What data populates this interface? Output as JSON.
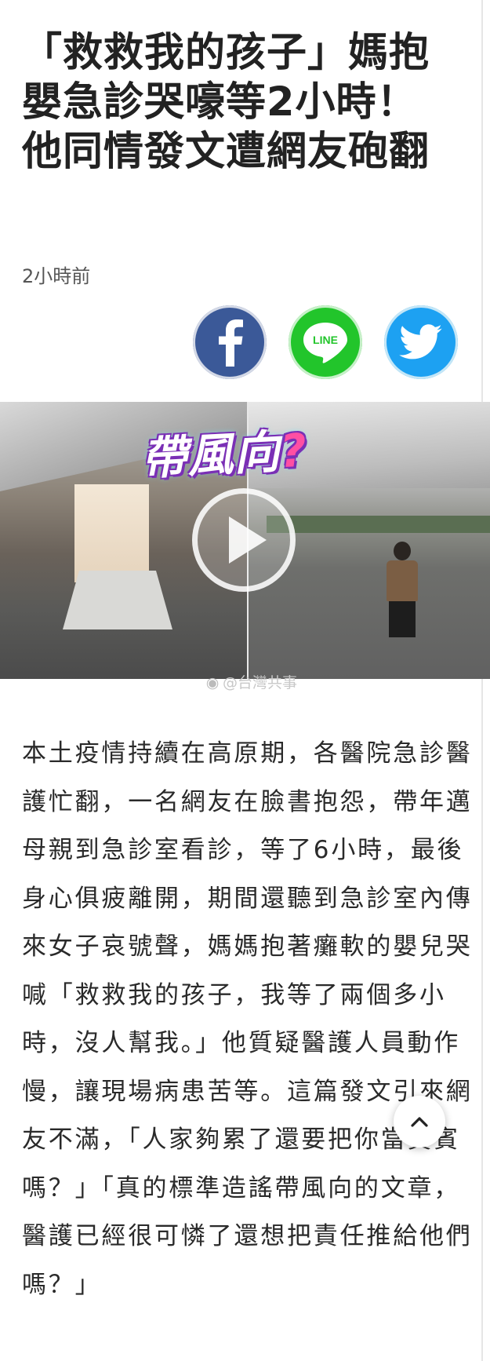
{
  "article": {
    "headline": "「救救我的孩子」媽抱嬰急診哭嚎等2小時！他同情發文遭網友砲翻",
    "timestamp": "2小時前",
    "body": "本土疫情持續在高原期，各醫院急診醫護忙翻，一名網友在臉書抱怨，帶年邁母親到急診室看診，等了6小時，最後身心俱疲離開，期間還聽到急診室內傳來女子哀號聲，媽媽抱著癱軟的嬰兒哭喊「救救我的孩子，我等了兩個多小時，沒人幫我。」他質疑醫護人員動作慢，讓現場病患苦等。這篇發文引來網友不滿，「人家夠累了還要把你當貴賓嗎？」「真的標準造謠帶風向的文章，醫護已經很可憐了還想把責任推給他們嗎？」"
  },
  "share": {
    "facebook_icon": "facebook-icon",
    "line_label": "LINE",
    "twitter_icon": "twitter-icon",
    "colors": {
      "facebook": "#3b5998",
      "line": "#22c52b",
      "twitter": "#1da1f2"
    }
  },
  "video": {
    "overlay_title": "帶風向",
    "overlay_mark": "?",
    "watermark": "@台灣共事",
    "play_icon": "play-icon"
  },
  "controls": {
    "scroll_top_icon": "chevron-up-icon"
  }
}
